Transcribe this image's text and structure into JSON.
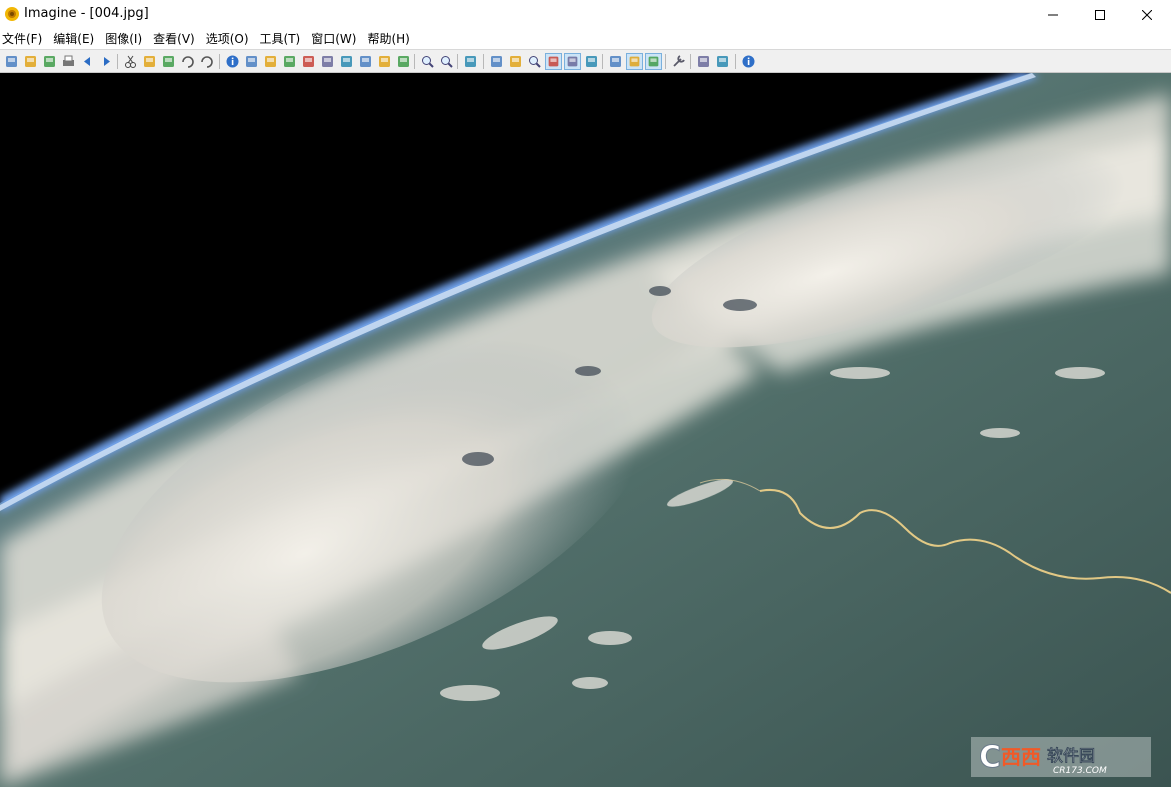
{
  "window": {
    "title": "Imagine - [004.jpg]",
    "app_icon": "sunflower-icon"
  },
  "menu": {
    "items": [
      {
        "label": "文件(F)"
      },
      {
        "label": "编辑(E)"
      },
      {
        "label": "图像(I)"
      },
      {
        "label": "查看(V)"
      },
      {
        "label": "选项(O)"
      },
      {
        "label": "工具(T)"
      },
      {
        "label": "窗口(W)"
      },
      {
        "label": "帮助(H)"
      }
    ]
  },
  "toolbar": {
    "buttons": [
      "new-icon",
      "open-icon",
      "save-icon",
      "print-icon",
      "prev-icon",
      "next-icon",
      "cut-icon",
      "copy-icon",
      "paste-icon",
      "undo-icon",
      "redo-icon",
      "info-icon",
      "camera-icon",
      "resize-icon",
      "crop-icon",
      "grayscale-icon",
      "invert-icon",
      "effects-icon",
      "color-icon",
      "rotate-left-icon",
      "rotate-right-icon",
      "zoom-in-icon",
      "zoom-out-icon",
      "select-icon",
      "slideshow-icon",
      "thumbnail-icon",
      "find-icon",
      "fit-window-icon",
      "actual-size-icon",
      "full-screen-icon",
      "monitor-icon",
      "image-view-icon",
      "paint-icon",
      "tools-icon",
      "layers-icon",
      "capture-icon",
      "help-icon"
    ]
  },
  "viewer": {
    "image": "earth-from-orbit-photo"
  },
  "watermark": {
    "brand": "西西软件园",
    "site": "CR173.COM"
  },
  "colors": {
    "toolbar_bg": "#f0f0f0",
    "space": "#000000",
    "atmosphere": "#5b8fd6",
    "ocean": "#4a6a68",
    "cloud": "#e8e6e0"
  }
}
